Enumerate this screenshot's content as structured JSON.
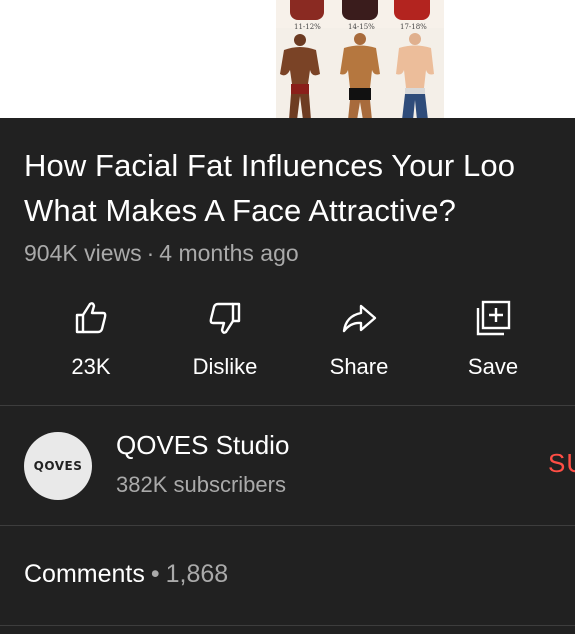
{
  "thumbnail": {
    "labels": [
      "11-12%",
      "14-15%",
      "17-18%"
    ]
  },
  "video": {
    "title_line1": "How Facial Fat Influences Your Loo",
    "title_line2": "What Makes A Face Attractive?",
    "views": "904K views",
    "separator": "·",
    "age": "4 months ago"
  },
  "actions": {
    "like": {
      "label": "23K",
      "icon": "thumbs-up-icon"
    },
    "dislike": {
      "label": "Dislike",
      "icon": "thumbs-down-icon"
    },
    "share": {
      "label": "Share",
      "icon": "share-arrow-icon"
    },
    "save": {
      "label": "Save",
      "icon": "add-to-playlist-icon"
    }
  },
  "channel": {
    "avatar_text": "QOVES",
    "name": "QOVES Studio",
    "subscribers": "382K subscribers",
    "subscribe_label": "SU"
  },
  "comments": {
    "label": "Comments",
    "separator": "•",
    "count": "1,868"
  },
  "colors": {
    "background": "#212121",
    "secondary_text": "#aaaaaa",
    "subscribe_red": "#ff4e45",
    "divider": "#3d3d3d"
  }
}
